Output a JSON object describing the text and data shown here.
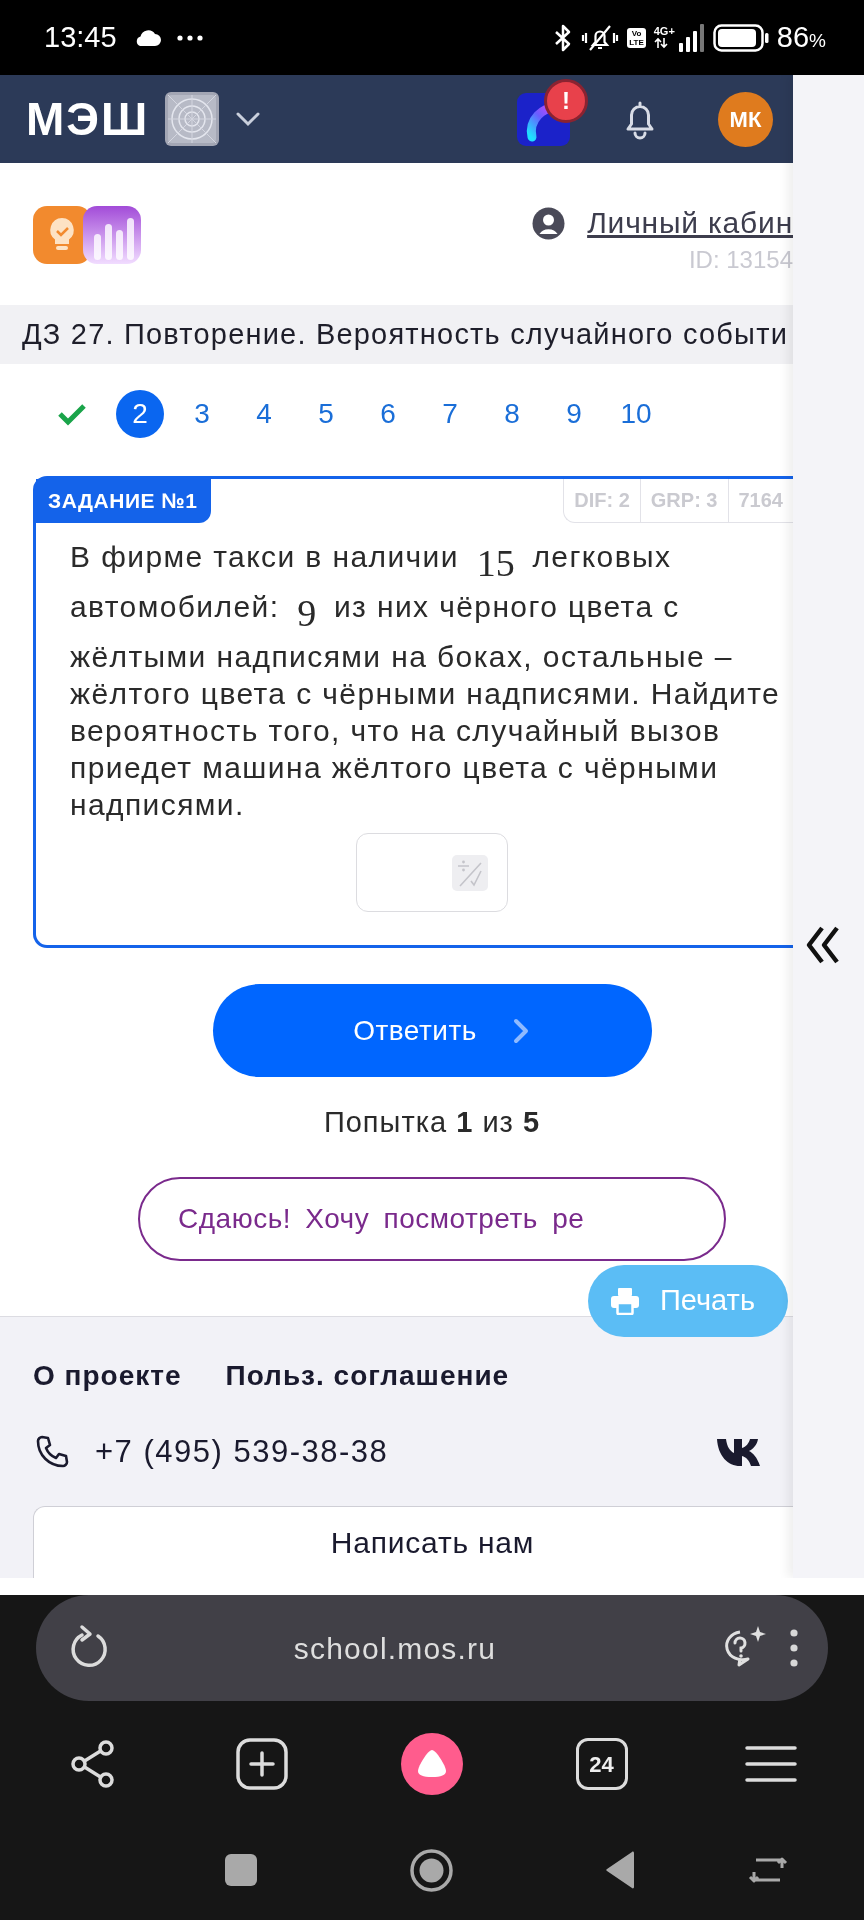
{
  "status_bar": {
    "time": "13:45",
    "network_badge": [
      "Vo",
      "LTE"
    ],
    "network": "4G+",
    "battery": "86",
    "battery_unit": "%"
  },
  "header": {
    "logo": "МЭШ",
    "alert_badge": "!",
    "avatar": "МК"
  },
  "profile": {
    "link": "Личный кабин",
    "id": "ID: 13154"
  },
  "title": "ДЗ 27. Повторение. Вероятность случайного событи",
  "task_nav": [
    {
      "kind": "done",
      "selected": false
    },
    {
      "kind": "number",
      "label": "2",
      "selected": true
    },
    {
      "kind": "number",
      "label": "3",
      "selected": false
    },
    {
      "kind": "number",
      "label": "4",
      "selected": false
    },
    {
      "kind": "number",
      "label": "5",
      "selected": false
    },
    {
      "kind": "number",
      "label": "6",
      "selected": false
    },
    {
      "kind": "number",
      "label": "7",
      "selected": false
    },
    {
      "kind": "number",
      "label": "8",
      "selected": false
    },
    {
      "kind": "number",
      "label": "9",
      "selected": false
    },
    {
      "kind": "number",
      "label": "10",
      "selected": false
    }
  ],
  "task": {
    "label": "ЗАДАНИЕ №1",
    "tags": [
      "DIF: 2",
      "GRP: 3",
      "7164"
    ],
    "text": [
      {
        "kind": "text",
        "text": "В фирме такси в наличии"
      },
      {
        "kind": "math",
        "text": "15"
      },
      {
        "kind": "text",
        "text": "легковых автомобилей:"
      },
      {
        "kind": "math",
        "text": "9"
      },
      {
        "kind": "text",
        "text": "из них чёрного цвета с жёлтыми надписями на боках, остальные – жёлтого цвета с чёрными надписями. Найдите вероятность того, что на случайный вызов приедет машина жёлтого цвета с чёрными надписями."
      }
    ]
  },
  "submit_button": "Ответить",
  "attempts": "Попытка **1** из **5**",
  "give_up_button": "Сдаюсь! Хочу посмотреть ре",
  "print_button": "Печать",
  "footer": {
    "links": [
      "О проекте",
      "Польз. соглашение"
    ],
    "phone": "+7 (495) 539-38-38",
    "contact_button": "Написать нам"
  },
  "browser": {
    "url": "school.mos.ru",
    "tab_count": "24"
  }
}
